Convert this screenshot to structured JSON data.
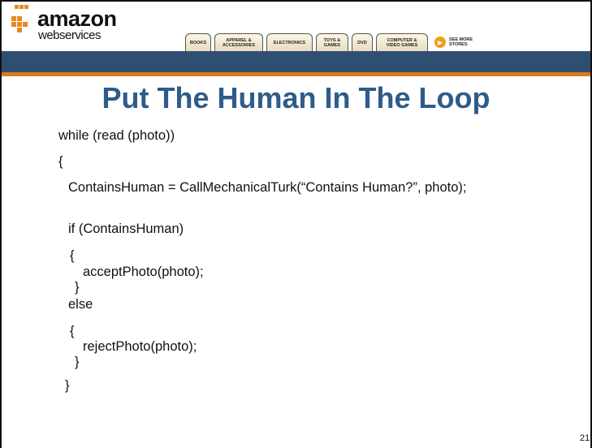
{
  "header": {
    "logo_amazon": "amazon",
    "logo_webservices": "webservices",
    "tabs": [
      "BOOKS",
      "APPAREL &\nACCESSORIES",
      "ELECTRONICS",
      "TOYS &\nGAMES",
      "DVD",
      "COMPUTER &\nVIDEO GAMES"
    ],
    "see_more": "SEE MORE\nSTORES",
    "colors": {
      "bar": "#2f4f72",
      "stripe": "#d97a1e",
      "accent_orange": "#f39c12"
    }
  },
  "slide": {
    "title": "Put The Human In The Loop",
    "title_color": "#2e5c8a",
    "code_lines": [
      "while (read (photo))",
      "{",
      "ContainsHuman = CallMechanicalTurk(“Contains Human?”, photo);",
      "if (ContainsHuman)",
      "{",
      "acceptPhoto(photo);",
      "}",
      "else",
      "{",
      "rejectPhoto(photo);",
      "}",
      "}"
    ],
    "page_number": "21"
  }
}
